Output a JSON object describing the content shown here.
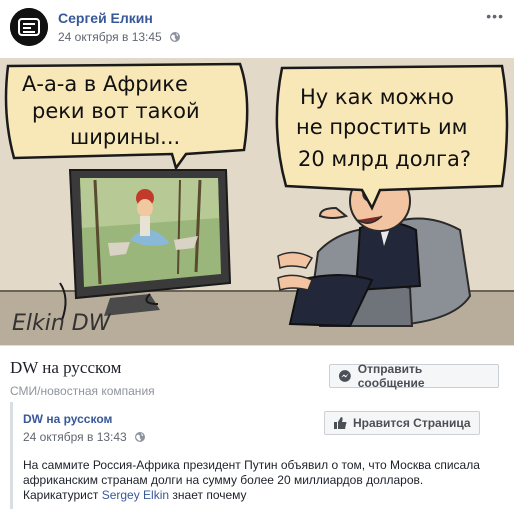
{
  "post": {
    "author": "Сергей Елкин",
    "timestamp": "24 октября в 13:45",
    "more_icon": "more-dots-icon",
    "privacy_icon": "globe-icon"
  },
  "cartoon": {
    "bubble_left_line1": "А-а-а в Африке",
    "bubble_left_line2": "реки вот такой",
    "bubble_left_line3": "ширины...",
    "bubble_right_line1": "Ну как можно",
    "bubble_right_line2": "не простить им",
    "bubble_right_line3": "20 млрд долга?",
    "signature": "Elkin DW"
  },
  "page": {
    "name": "DW на русском",
    "category": "СМИ/новостная компания",
    "message_button": "Отправить сообщение",
    "like_button": "Нравится Страница"
  },
  "shared": {
    "name": "DW на русском",
    "timestamp": "24 октября в 13:43",
    "text_line1": "На саммите Россия-Африка президент Путин объявил о том, что Москва списала",
    "text_line2": "африканским странам долги на сумму более 20 миллиардов долларов.",
    "text_line3_prefix": "Карикатурист",
    "text_line3_link": "Sergey Elkin",
    "text_line3_suffix": "знает почему"
  }
}
